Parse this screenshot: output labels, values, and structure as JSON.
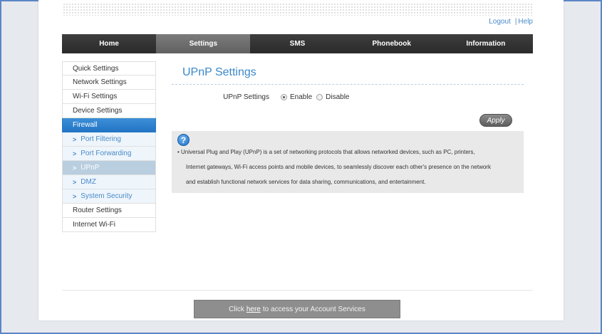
{
  "header": {
    "logout": "Logout",
    "help": "Help",
    "separator": "|"
  },
  "nav": {
    "items": [
      {
        "label": "Home"
      },
      {
        "label": "Settings"
      },
      {
        "label": "SMS"
      },
      {
        "label": "Phonebook"
      },
      {
        "label": "Information"
      }
    ],
    "active": "Settings"
  },
  "sidebar": {
    "items": [
      {
        "label": "Quick Settings"
      },
      {
        "label": "Network Settings"
      },
      {
        "label": "Wi-Fi Settings"
      },
      {
        "label": "Device Settings"
      },
      {
        "label": "Firewall"
      },
      {
        "label": "Port Filtering"
      },
      {
        "label": "Port Forwarding"
      },
      {
        "label": "UPnP"
      },
      {
        "label": "DMZ"
      },
      {
        "label": "System Security"
      },
      {
        "label": "Router Settings"
      },
      {
        "label": "Internet Wi-Fi"
      }
    ],
    "chevron": ">"
  },
  "main": {
    "title": "UPnP Settings",
    "setting_label": "UPnP Settings",
    "options": [
      {
        "label": "Enable",
        "checked": true
      },
      {
        "label": "Disable",
        "checked": false
      }
    ],
    "apply_label": "Apply",
    "help_icon": "?",
    "help_lines": [
      "• Universal Plug and Play (UPnP) is a set of networking protocols that allows networked devices, such as PC, printers,",
      "Internet gateways, Wi-Fi access points and mobile devices, to seamlessly discover each other's presence on the network",
      "and establish functional network services for data sharing, communications, and entertainment."
    ]
  },
  "footer": {
    "prefix": "Click",
    "link": "here",
    "suffix": "to access your Account Services"
  },
  "colors": {
    "accent": "#3a88c8",
    "nav_bg": "#333333",
    "active_side": "#2a7ac7"
  }
}
